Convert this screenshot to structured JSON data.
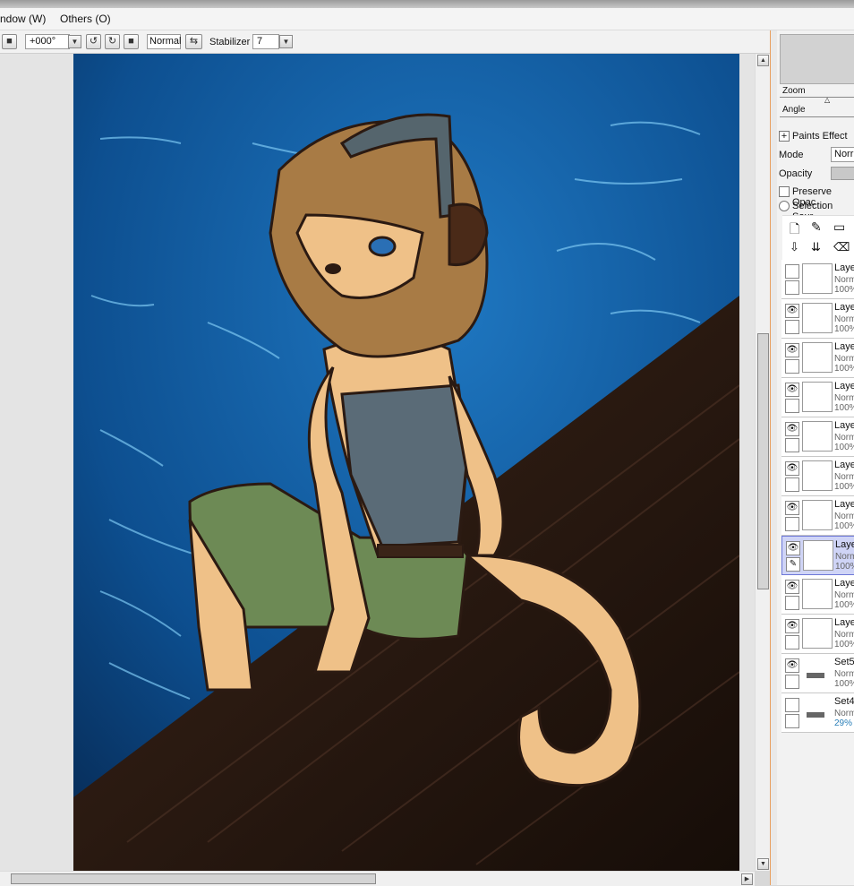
{
  "menu": {
    "window": "ndow (W)",
    "others": "Others (O)"
  },
  "toolbar": {
    "rotation": "+000°",
    "blend_mode": "Normal",
    "stabilizer_label": "Stabilizer",
    "stabilizer_value": "7"
  },
  "navigator": {
    "zoom_label": "Zoom",
    "angle_label": "Angle"
  },
  "layer_panel": {
    "paints_effect": "Paints Effect",
    "mode_label": "Mode",
    "mode_value": "Norr",
    "opacity_label": "Opacity",
    "preserve_opacity": "Preserve Opac",
    "selection_source": "Selection Sour",
    "layers": [
      {
        "name": "Laye",
        "mode": "Norm",
        "opacity": "100%"
      },
      {
        "name": "Laye",
        "mode": "Norm",
        "opacity": "100%"
      },
      {
        "name": "Laye",
        "mode": "Norm",
        "opacity": "100%"
      },
      {
        "name": "Laye",
        "mode": "Norm",
        "opacity": "100%"
      },
      {
        "name": "Laye",
        "mode": "Norm",
        "opacity": "100%"
      },
      {
        "name": "Laye",
        "mode": "Norm",
        "opacity": "100%"
      },
      {
        "name": "Laye",
        "mode": "Norm",
        "opacity": "100%"
      },
      {
        "name": "Laye",
        "mode": "Norm",
        "opacity": "100%"
      },
      {
        "name": "Laye",
        "mode": "Norm",
        "opacity": "100%"
      },
      {
        "name": "Laye",
        "mode": "Norm",
        "opacity": "100%"
      },
      {
        "name": "Set5",
        "mode": "Norm",
        "opacity": "100%"
      },
      {
        "name": "Set4",
        "mode": "Norm",
        "opacity": "29%"
      }
    ]
  },
  "colors": {
    "accent_selected": "#cfd4f6",
    "panel_border": "#e8a060"
  }
}
